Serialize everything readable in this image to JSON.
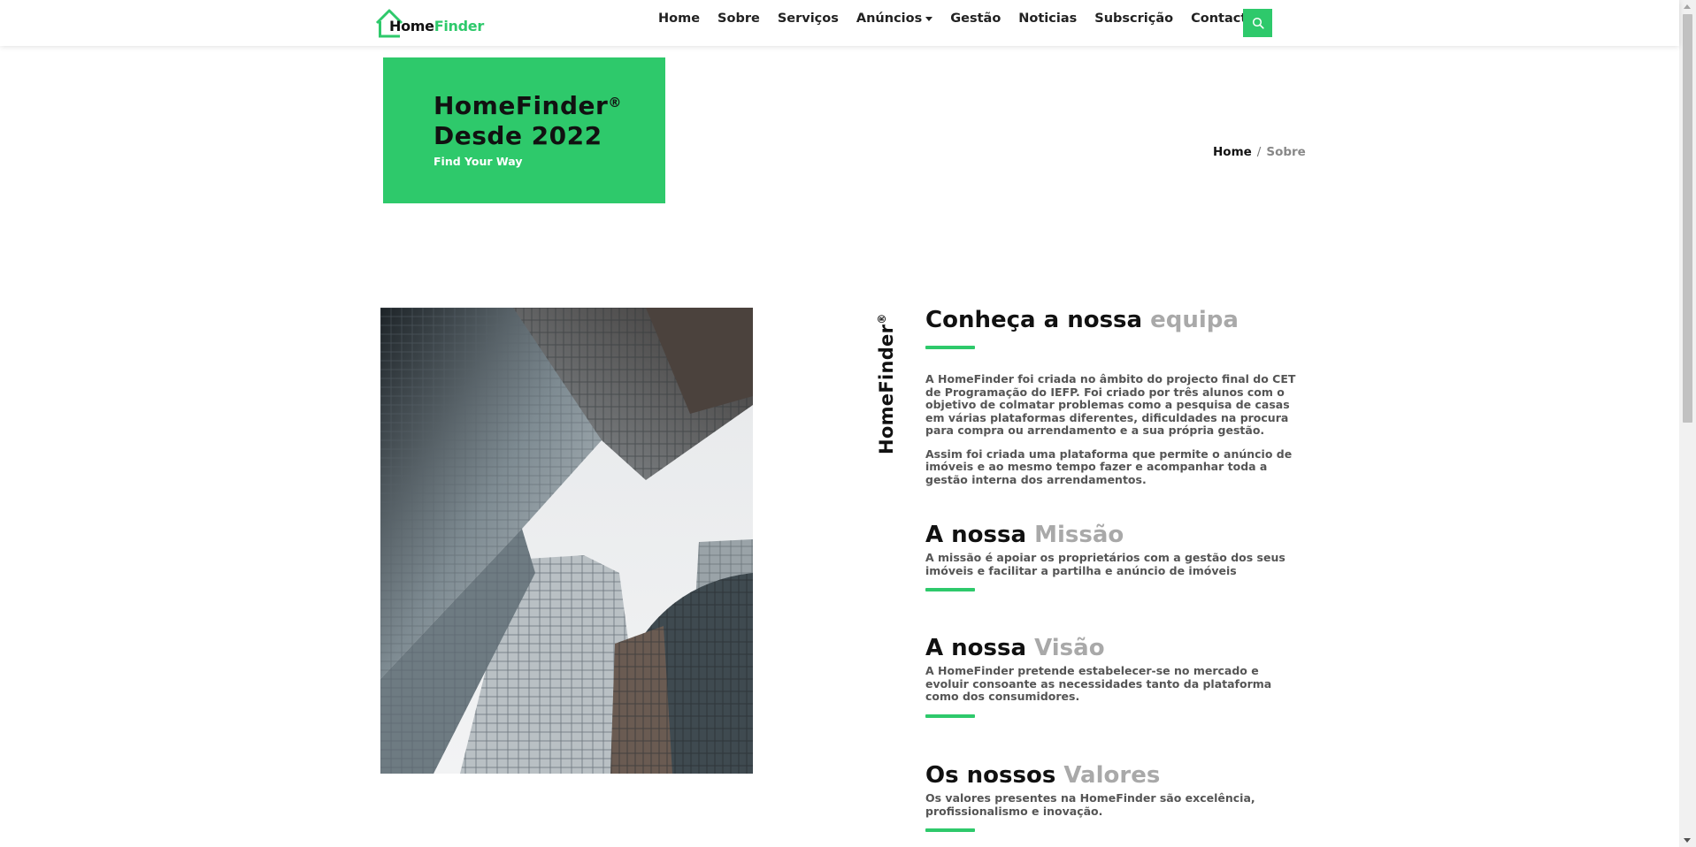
{
  "nav": {
    "logo_home": "Home",
    "logo_finder": "Finder",
    "items": [
      "Home",
      "Sobre",
      "Serviços",
      "Anúncios",
      "Gestão",
      "Noticias",
      "Subscrição",
      "Contactos"
    ],
    "search_icon": "search-icon",
    "accent_color": "#2ec96b"
  },
  "hero": {
    "title_line1": "HomeFinder",
    "registered": "®",
    "title_line2": "Desde 2022",
    "subtitle": "Find Your Way"
  },
  "breadcrumb": {
    "home": "Home",
    "separator": "/",
    "current": "Sobre"
  },
  "vertical_brand": "HomeFinder",
  "vertical_registered": "®",
  "sections": {
    "team": {
      "title_dark": "Conheça a nossa",
      "title_gray": "equipa",
      "paragraph1": "A HomeFinder foi criada no âmbito do projecto final do CET de Programação do IEFP. Foi criado por três alunos com o objetivo de colmatar problemas como a pesquisa de casas em várias plataformas diferentes, dificuldades na procura para compra ou arrendamento e a sua própria gestão.",
      "paragraph2": "Assim foi criada uma plataforma que permite o anúncio de imóveis e ao mesmo tempo fazer e acompanhar toda a gestão interna dos arrendamentos."
    },
    "mission": {
      "title_dark": "A nossa",
      "title_gray": "Missão",
      "paragraph": "A missão é apoiar os proprietários com a gestão dos seus imóveis e facilitar a partilha e anúncio de imóveis"
    },
    "vision": {
      "title_dark": "A nossa",
      "title_gray": "Visão",
      "paragraph": "A HomeFinder pretende estabelecer-se no mercado e evoluir consoante as necessidades tanto da plataforma como dos consumidores."
    },
    "values": {
      "title_dark": "Os nossos",
      "title_gray": "Valores",
      "paragraph": "Os valores presentes na HomeFinder são excelência, profissionalismo e inovação."
    }
  }
}
